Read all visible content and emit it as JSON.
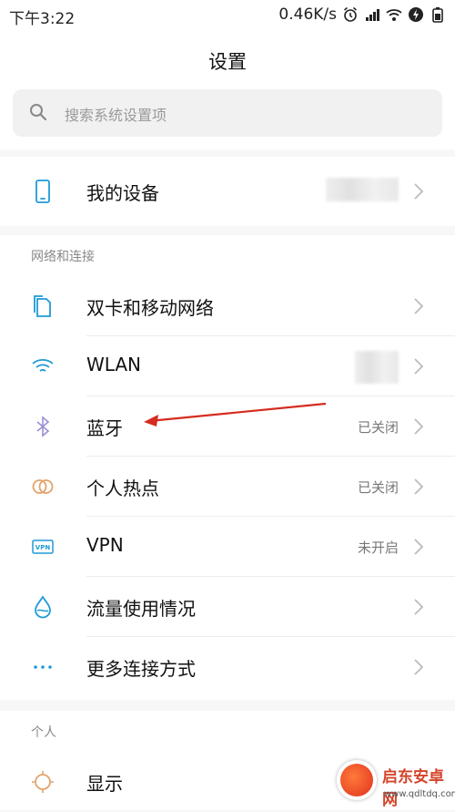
{
  "statusbar": {
    "time": "下午3:22",
    "net_speed": "0.46K/s"
  },
  "header": {
    "title": "设置",
    "search_placeholder": "搜索系统设置项"
  },
  "device": {
    "label": "我的设备"
  },
  "network_section": {
    "label": "网络和连接",
    "items": [
      {
        "label": "双卡和移动网络",
        "value": "",
        "icon": "sim-cards-icon"
      },
      {
        "label": "WLAN",
        "value": "",
        "icon": "wifi-icon"
      },
      {
        "label": "蓝牙",
        "value": "已关闭",
        "icon": "bluetooth-icon"
      },
      {
        "label": "个人热点",
        "value": "已关闭",
        "icon": "hotspot-icon"
      },
      {
        "label": "VPN",
        "value": "未开启",
        "icon": "vpn-icon"
      },
      {
        "label": "流量使用情况",
        "value": "",
        "icon": "data-usage-icon"
      },
      {
        "label": "更多连接方式",
        "value": "",
        "icon": "more-dots-icon"
      }
    ]
  },
  "personal_section": {
    "label": "个人",
    "items": [
      {
        "label": "显示",
        "value": "",
        "icon": "display-sun-icon"
      }
    ]
  },
  "watermark": {
    "name": "启东安卓网",
    "url": "www.qdltdq.com"
  },
  "colors": {
    "accent_blue": "#1e9bd7",
    "annotation_red": "#d62b1f",
    "bluetooth_purple": "#9c8fd6",
    "hotspot_orange": "#e3a26b"
  }
}
